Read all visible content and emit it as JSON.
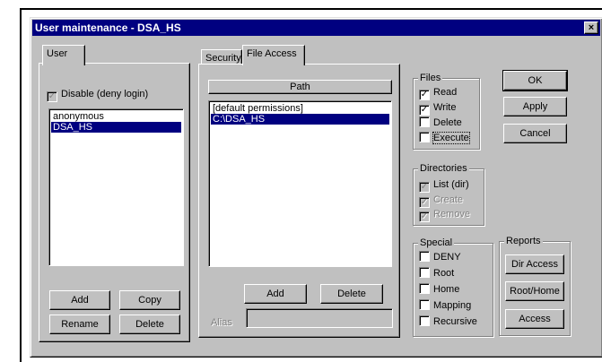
{
  "window": {
    "title": "User maintenance - DSA_HS",
    "close_glyph": "×"
  },
  "user_panel": {
    "tab_label": "User",
    "disable_label": "Disable (deny login)",
    "disable_checked": true,
    "users": [
      "anonymous",
      "DSA_HS"
    ],
    "selected_user": "DSA_HS",
    "add_label": "Add",
    "copy_label": "Copy",
    "rename_label": "Rename",
    "delete_label": "Delete"
  },
  "tabs": {
    "security": "Security",
    "file_access": "File Access"
  },
  "path_panel": {
    "header": "Path",
    "paths": [
      "[default permissions]",
      "C:\\DSA_HS"
    ],
    "add_label": "Add",
    "delete_label": "Delete",
    "alias_label": "Alias",
    "alias_value": ""
  },
  "files": {
    "label": "Files",
    "read": "Read",
    "write": "Write",
    "delete": "Delete",
    "execute": "Execute",
    "check_glyph": "✓"
  },
  "directories": {
    "label": "Directories",
    "list": "List (dir)",
    "create": "Create",
    "remove": "Remove"
  },
  "special": {
    "label": "Special",
    "deny": "DENY",
    "root": "Root",
    "home": "Home",
    "mapping": "Mapping",
    "recursive": "Recursive"
  },
  "dialog_buttons": {
    "ok": "OK",
    "apply": "Apply",
    "cancel": "Cancel"
  },
  "reports": {
    "label": "Reports",
    "dir_access": "Dir Access",
    "root_home": "Root/Home",
    "access": "Access"
  },
  "colors": {
    "face": "#c0c0c0",
    "title": "#000080",
    "selection": "#000080"
  }
}
